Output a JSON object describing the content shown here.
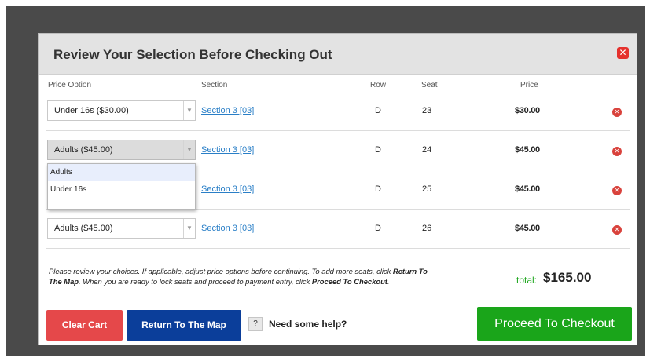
{
  "modal": {
    "title": "Review Your Selection Before Checking Out",
    "close_icon": "close-icon"
  },
  "columns": {
    "price_option": "Price Option",
    "section": "Section",
    "row": "Row",
    "seat": "Seat",
    "price": "Price"
  },
  "rows": [
    {
      "price_option": "Under 16s ($30.00)",
      "section": "Section 3 [03]",
      "row": "D",
      "seat": "23",
      "price": "$30.00"
    },
    {
      "price_option": "Adults ($45.00)",
      "section": "Section 3 [03]",
      "row": "D",
      "seat": "24",
      "price": "$45.00"
    },
    {
      "price_option": "",
      "section": "Section 3 [03]",
      "row": "D",
      "seat": "25",
      "price": "$45.00"
    },
    {
      "price_option": "Adults ($45.00)",
      "section": "Section 3 [03]",
      "row": "D",
      "seat": "26",
      "price": "$45.00"
    }
  ],
  "dropdown": {
    "options": [
      "Adults",
      "Under 16s"
    ],
    "highlighted": "Adults"
  },
  "footer": {
    "note_1": "Please review your choices. If applicable, adjust price options before continuing. To add more seats, click ",
    "note_bold_1": "Return To The Map",
    "note_2": ". When you are ready to lock seats and proceed to payment entry, click ",
    "note_bold_2": "Proceed To Checkout",
    "note_3": ".",
    "total_label": "total:",
    "total_value": "$165.00"
  },
  "buttons": {
    "clear_cart": "Clear Cart",
    "return_map": "Return To The Map",
    "help_icon": "?",
    "help_text": "Need some help?",
    "checkout": "Proceed To Checkout"
  },
  "colors": {
    "clear_cart": "#e5484a",
    "return_map": "#0b3e9a",
    "checkout": "#1aa51a",
    "link": "#2a7fc7",
    "total_label": "#21a821"
  }
}
